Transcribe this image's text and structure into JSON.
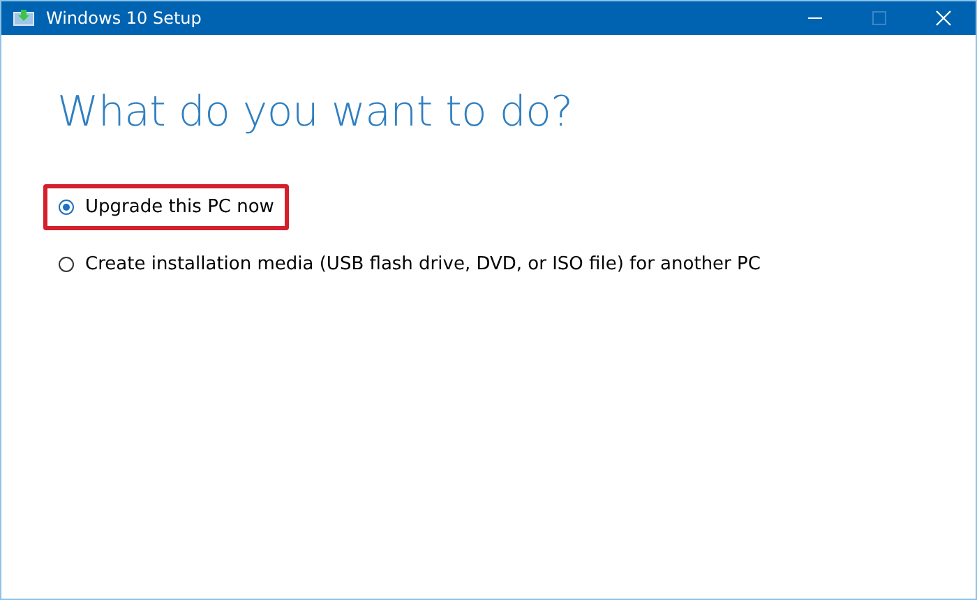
{
  "window": {
    "title": "Windows 10 Setup",
    "maximize_disabled": true
  },
  "heading": "What do you want to do?",
  "options": [
    {
      "label": "Upgrade this PC now",
      "selected": true,
      "highlighted": true
    },
    {
      "label": "Create installation media (USB flash drive, DVD, or ISO file) for another PC",
      "selected": false,
      "highlighted": false
    }
  ]
}
